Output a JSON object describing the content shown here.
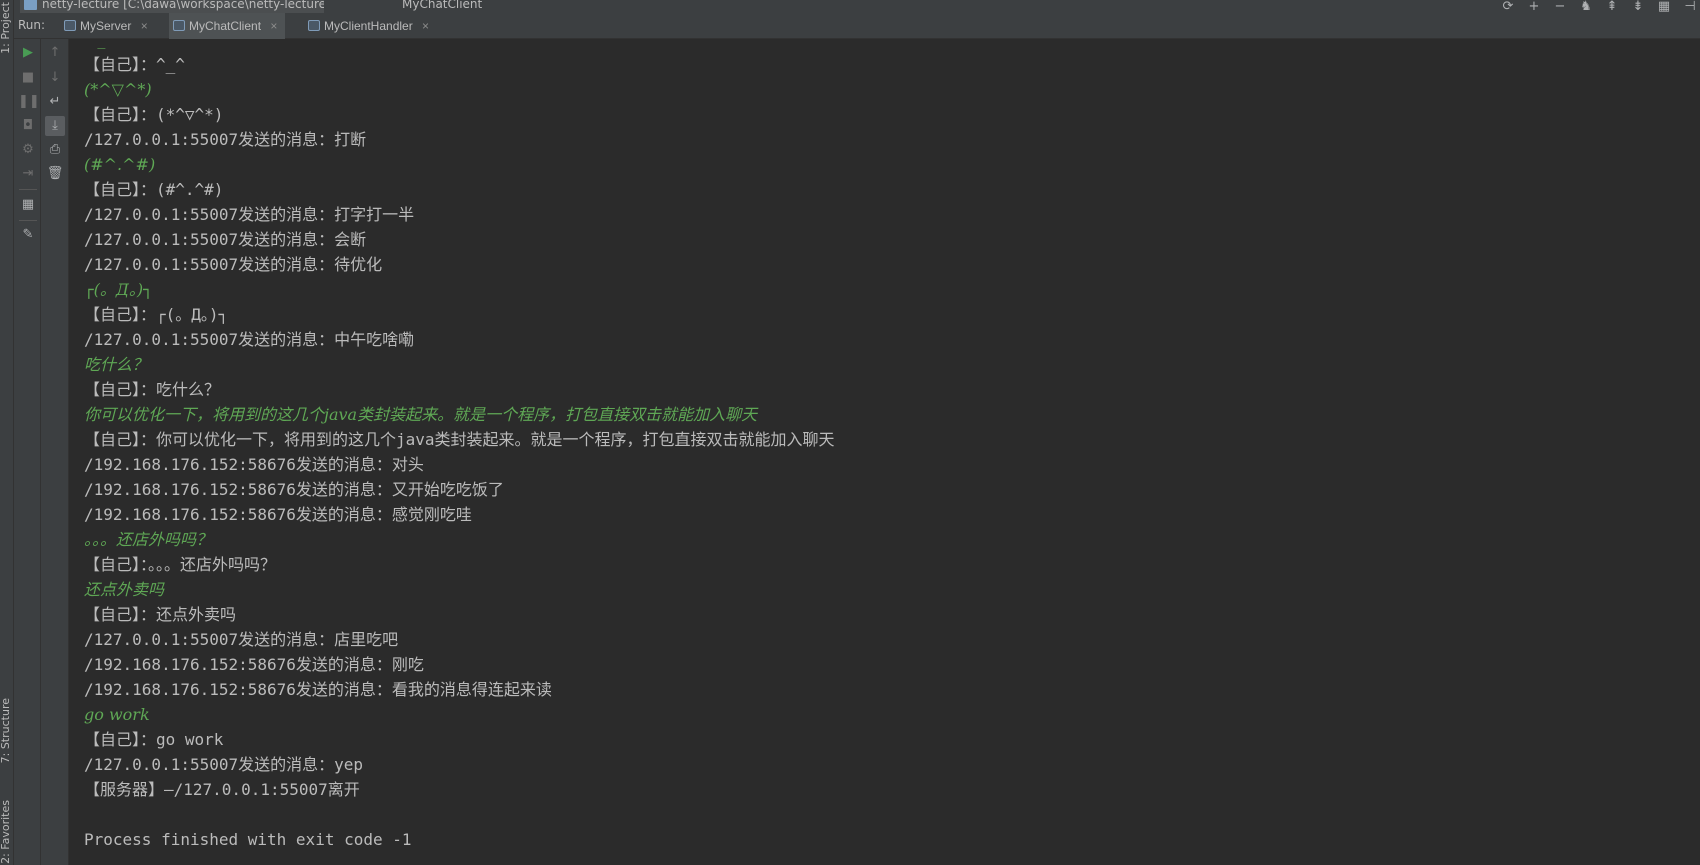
{
  "window": {
    "project_tab": "netty-lecture [C:\\dawa\\workspace\\netty-lecture]",
    "title": "MyChatClient"
  },
  "left_stripe": {
    "project_label": "1: Project",
    "structure_label": "7: Structure",
    "favorites_label": "2: Favorites"
  },
  "run": {
    "label": "Run:",
    "tabs": [
      {
        "label": "MyServer"
      },
      {
        "label": "MyChatClient"
      },
      {
        "label": "MyClientHandler"
      }
    ]
  },
  "console": {
    "lines": [
      {
        "text": "^_^",
        "kind": "input"
      },
      {
        "text": "【自己】：^_^",
        "kind": "output"
      },
      {
        "text": "(*^▽^*)",
        "kind": "input"
      },
      {
        "text": "【自己】：(*^▽^*)",
        "kind": "output"
      },
      {
        "text": "/127.0.0.1:55007发送的消息：打断",
        "kind": "output"
      },
      {
        "text": "(#^.^#)",
        "kind": "input"
      },
      {
        "text": "【自己】：(#^.^#)",
        "kind": "output"
      },
      {
        "text": "/127.0.0.1:55007发送的消息：打字打一半",
        "kind": "output"
      },
      {
        "text": "/127.0.0.1:55007发送的消息：会断",
        "kind": "output"
      },
      {
        "text": "/127.0.0.1:55007发送的消息：待优化",
        "kind": "output"
      },
      {
        "text": "┌(。Д。)┐",
        "kind": "input"
      },
      {
        "text": "【自己】：┌(。Д。)┐",
        "kind": "output"
      },
      {
        "text": "/127.0.0.1:55007发送的消息：中午吃啥嘞",
        "kind": "output"
      },
      {
        "text": "吃什么？",
        "kind": "input"
      },
      {
        "text": "【自己】：吃什么？",
        "kind": "output"
      },
      {
        "text": "你可以优化一下，将用到的这几个java类封装起来。就是一个程序，打包直接双击就能加入聊天",
        "kind": "input"
      },
      {
        "text": "【自己】：你可以优化一下，将用到的这几个java类封装起来。就是一个程序，打包直接双击就能加入聊天",
        "kind": "output"
      },
      {
        "text": "/192.168.176.152:58676发送的消息：对头",
        "kind": "output"
      },
      {
        "text": "/192.168.176.152:58676发送的消息：又开始吃吃饭了",
        "kind": "output"
      },
      {
        "text": "/192.168.176.152:58676发送的消息：感觉刚吃哇",
        "kind": "output"
      },
      {
        "text": "。。。还店外吗吗？",
        "kind": "input"
      },
      {
        "text": "【自己】：。。。还店外吗吗？",
        "kind": "output"
      },
      {
        "text": "还点外卖吗",
        "kind": "input"
      },
      {
        "text": "【自己】：还点外卖吗",
        "kind": "output"
      },
      {
        "text": "/127.0.0.1:55007发送的消息：店里吃吧",
        "kind": "output"
      },
      {
        "text": "/192.168.176.152:58676发送的消息：刚吃",
        "kind": "output"
      },
      {
        "text": "/192.168.176.152:58676发送的消息：看我的消息得连起来读",
        "kind": "output"
      },
      {
        "text": "go work",
        "kind": "input"
      },
      {
        "text": "【自己】：go work",
        "kind": "output"
      },
      {
        "text": "/127.0.0.1:55007发送的消息：yep",
        "kind": "output"
      },
      {
        "text": "【服务器】—/127.0.0.1:55007离开",
        "kind": "output"
      },
      {
        "text": "",
        "kind": "blank"
      },
      {
        "text": "Process finished with exit code -1",
        "kind": "output"
      }
    ]
  },
  "colors": {
    "background": "#2b2b2b",
    "output_text": "#bbbbbb",
    "input_text": "#5fa855",
    "panel": "#3c3f41"
  }
}
